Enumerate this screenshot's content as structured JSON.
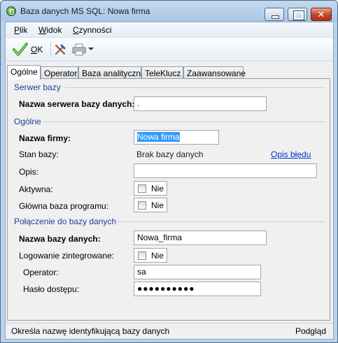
{
  "window": {
    "title": "Baza danych MS SQL: Nowa firma",
    "close_glyph": "✕"
  },
  "menu": {
    "items": [
      "Plik",
      "Widok",
      "Czynności"
    ]
  },
  "toolbar": {
    "ok_label": "OK",
    "icons": [
      "check-icon",
      "tools-icon",
      "printer-icon",
      "chevron-down-icon"
    ]
  },
  "tabs": [
    {
      "label": "Ogólne",
      "active": true
    },
    {
      "label": "Operator"
    },
    {
      "label": "Baza analityczna"
    },
    {
      "label": "TeleKlucz"
    },
    {
      "label": "Zaawansowane"
    }
  ],
  "server_section": {
    "title": "Serwer bazy",
    "server_name_label": "Nazwa serwera bazy danych:",
    "server_name_value": "."
  },
  "general_section": {
    "title": "Ogólne",
    "company_name_label": "Nazwa firmy:",
    "company_name_value": "Nowa firma",
    "db_state_label": "Stan bazy:",
    "db_state_value": "Brak bazy danych",
    "error_link": "Opis błędu",
    "description_label": "Opis:",
    "description_value": "",
    "active_label": "Aktywna:",
    "active_checkbox_text": "Nie",
    "main_db_label": "Główna baza programu:",
    "main_db_checkbox_text": "Nie"
  },
  "connection_section": {
    "title": "Połączenie do bazy danych",
    "db_name_label": "Nazwa bazy danych:",
    "db_name_value": "Nowa_firma",
    "integrated_login_label": "Logowanie zintegrowane:",
    "integrated_login_checkbox_text": "Nie",
    "operator_label": "Operator:",
    "operator_value": "sa",
    "password_label": "Hasło dostępu:",
    "password_value": "●●●●●●●●●●"
  },
  "statusbar": {
    "hint": "Określa nazwę identyfikującą bazy danych",
    "mode": "Podgląd"
  },
  "colors": {
    "title_bar": "#b9d1ea",
    "group_title": "#1c3f94",
    "link": "#0033cc",
    "selection": "#3399ff",
    "close_button": "#c2432b"
  }
}
